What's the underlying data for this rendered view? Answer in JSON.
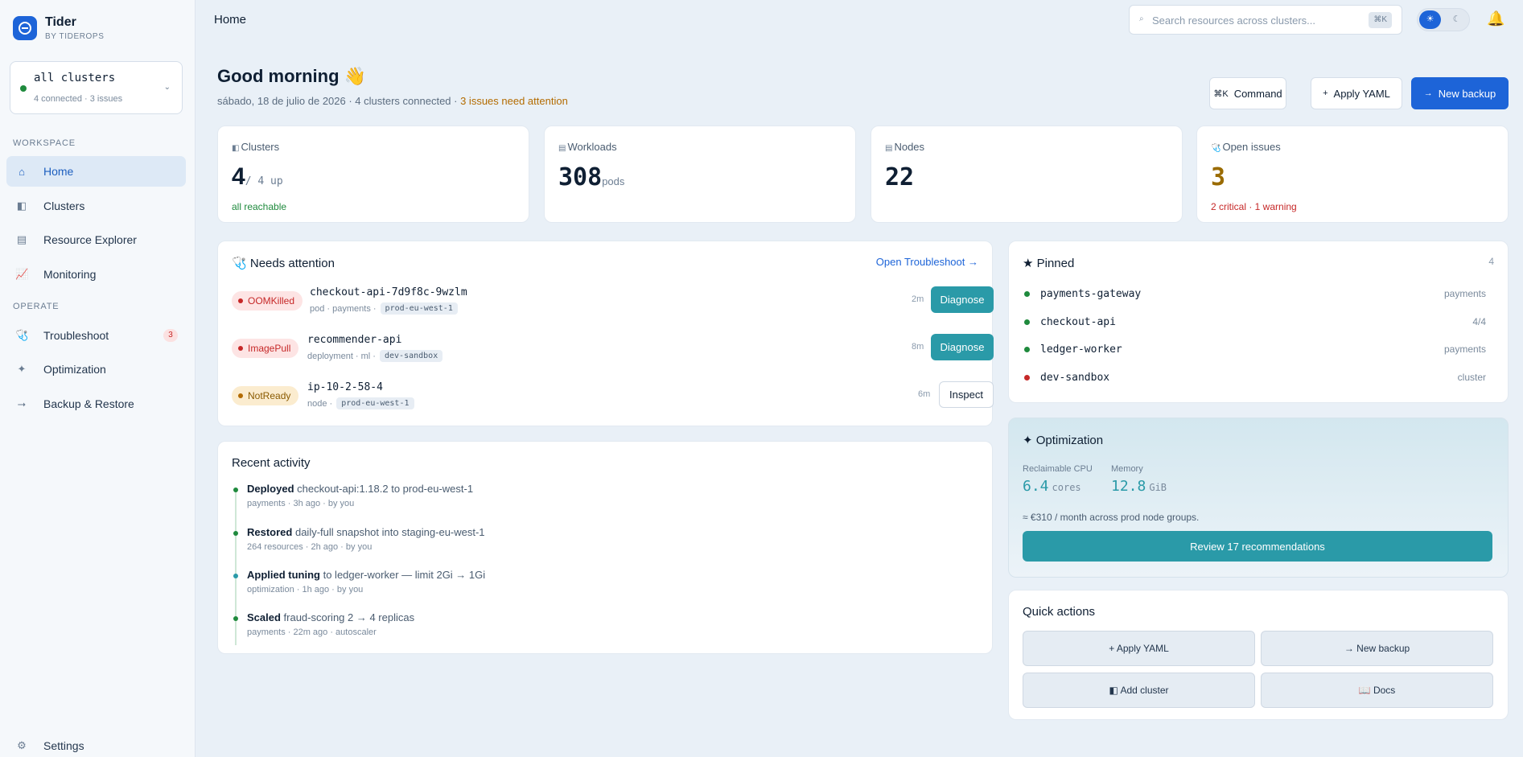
{
  "brand": {
    "name": "Tider",
    "sub": "BY TIDEROPS"
  },
  "cluster_selector": {
    "title": "all clusters",
    "sub": "4 connected · 3 issues",
    "caret": "⌄"
  },
  "sidebar": {
    "section_workspace": "WORKSPACE",
    "section_operate": "OPERATE",
    "items": [
      {
        "label": "Home",
        "icon": "⌂"
      },
      {
        "label": "Clusters",
        "icon": "◧"
      },
      {
        "label": "Resource Explorer",
        "icon": "▤"
      },
      {
        "label": "Monitoring",
        "icon": "📈"
      },
      {
        "label": "Troubleshoot",
        "icon": "🩺",
        "badge": "3"
      },
      {
        "label": "Optimization",
        "icon": "✦"
      },
      {
        "label": "Backup & Restore",
        "icon": "⭢"
      },
      {
        "label": "Settings",
        "icon": "⚙"
      }
    ]
  },
  "topbar": {
    "title": "Home",
    "search_placeholder": "Search resources across clusters...",
    "search_shortcut": "⌘K",
    "theme_light": "☀",
    "theme_dark": "☾",
    "bell": "🔔"
  },
  "header": {
    "greeting": "Good morning 👋",
    "date_line": "sábado, 18 de julio de 2026 · 4 clusters connected · ",
    "issues_text": "3 issues need attention",
    "buttons": {
      "command_icon": "⌘K",
      "command": "Command",
      "apply_icon": "+",
      "apply": "Apply YAML",
      "backup_icon": "→",
      "backup": "New backup"
    }
  },
  "stats": [
    {
      "icon": "◧",
      "label": "Clusters",
      "value": "4",
      "unit": "/ 4 up",
      "note": "all reachable",
      "value_color": "#0f1f33",
      "note_color": "#1f8a3d"
    },
    {
      "icon": "▤",
      "label": "Workloads",
      "value": "308",
      "unit": "pods",
      "note": "",
      "value_color": "#0f1f33",
      "note_color": "#1f8a3d"
    },
    {
      "icon": "▤",
      "label": "Nodes",
      "value": "22",
      "unit": "",
      "note": "",
      "value_color": "#0f1f33",
      "note_color": "#1f8a3d"
    },
    {
      "icon": "🩺",
      "label": "Open issues",
      "value": "3",
      "unit": "",
      "note": "2 critical · 1 warning",
      "value_color": "#9a6b00",
      "note_color": "#c62828"
    }
  ],
  "attention": {
    "icon": "🩺",
    "title": "Needs attention",
    "link": "Open Troubleshoot →",
    "rows": [
      {
        "status": "OOMKilled",
        "name": "checkout-api-7d9f8c-9wzlm",
        "meta": "pod · payments ·",
        "tag": "prod-eu-west-1",
        "time": "2m",
        "action": "Diagnose"
      },
      {
        "status": "ImagePull",
        "name": "recommender-api",
        "meta": "deployment · ml ·",
        "tag": "dev-sandbox",
        "time": "8m",
        "action": "Diagnose"
      },
      {
        "status": "NotReady",
        "name": "ip-10-2-58-4",
        "meta": "node ·",
        "tag": "prod-eu-west-1",
        "time": "6m",
        "action": "Inspect"
      }
    ]
  },
  "activity": {
    "title": "Recent activity",
    "items": [
      {
        "verb": "Deployed",
        "text": " checkout-api:1.18.2 to prod-eu-west-1",
        "meta": "payments · 3h ago · by you",
        "color": "#1f8a3d"
      },
      {
        "verb": "Restored",
        "text": " daily-full snapshot into staging-eu-west-1",
        "meta": "264 resources · 2h ago · by you",
        "color": "#1f8a3d"
      },
      {
        "verb": "Applied tuning",
        "text": " to ledger-worker — limit 2Gi → 1Gi",
        "meta": "optimization · 1h ago · by you",
        "color": "#2a9aa8"
      },
      {
        "verb": "Scaled",
        "text": " fraud-scoring 2 → 4 replicas",
        "meta": "payments · 22m ago · autoscaler",
        "color": "#1f8a3d"
      }
    ]
  },
  "pinned": {
    "icon": "★",
    "title": "Pinned",
    "count": "4",
    "items": [
      {
        "name": "payments-gateway",
        "context": "payments",
        "color": "#1f8a3d"
      },
      {
        "name": "checkout-api",
        "context": "4/4",
        "color": "#1f8a3d"
      },
      {
        "name": "ledger-worker",
        "context": "payments",
        "color": "#1f8a3d"
      },
      {
        "name": "dev-sandbox",
        "context": "cluster",
        "color": "#c62828"
      }
    ]
  },
  "optimization": {
    "icon": "✦",
    "title": "Optimization",
    "cpu_label": "Reclaimable CPU",
    "cpu_value": "6.4",
    "cpu_unit": "cores",
    "mem_label": "Memory",
    "mem_value": "12.8",
    "mem_unit": "GiB",
    "note": "≈ €310 / month across prod node groups.",
    "button": "Review 17 recommendations"
  },
  "quick_actions": {
    "title": "Quick actions",
    "items": [
      {
        "label": "+ Apply YAML"
      },
      {
        "label": "→ New backup"
      },
      {
        "label": "◧ Add cluster"
      },
      {
        "label": "📖 Docs"
      }
    ]
  }
}
